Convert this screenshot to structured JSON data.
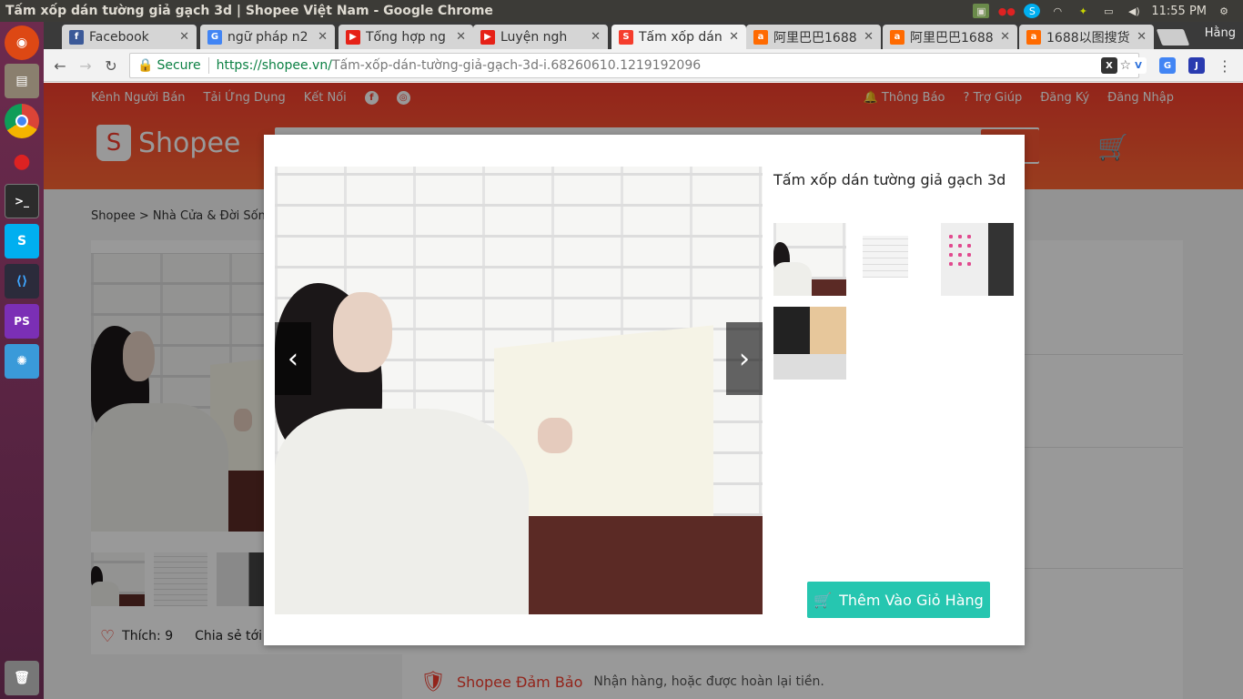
{
  "window": {
    "title": "Tấm xốp dán tường giả gạch 3d | Shopee Việt Nam - Google Chrome",
    "clock": "11:55 PM"
  },
  "tabs": [
    {
      "label": "Facebook",
      "icon": "facebook-icon",
      "color": "#3b5998",
      "glyph": "f"
    },
    {
      "label": "ngữ pháp n2",
      "icon": "google-icon",
      "color": "#4285f4",
      "glyph": "G"
    },
    {
      "label": "Tổng hợp ng",
      "icon": "youtube-icon",
      "color": "#e62117",
      "glyph": "▶"
    },
    {
      "label": "Luyện ngh",
      "icon": "youtube-icon",
      "color": "#e62117",
      "glyph": "▶"
    },
    {
      "label": "Tấm xốp dán",
      "icon": "shopee-icon",
      "color": "#f53d2d",
      "glyph": "S"
    },
    {
      "label": "阿里巴巴1688",
      "icon": "alibaba-icon",
      "color": "#ff6a00",
      "glyph": "a"
    },
    {
      "label": "阿里巴巴1688",
      "icon": "alibaba-icon",
      "color": "#ff6a00",
      "glyph": "a"
    },
    {
      "label": "1688以图搜货",
      "icon": "alibaba-icon",
      "color": "#ff6a00",
      "glyph": "a"
    }
  ],
  "user_chip": "Hằng",
  "address": {
    "secure_label": "Secure",
    "url_scheme_host": "https://shopee.vn/",
    "url_path": "Tấm-xốp-dán-tường-giả-gạch-3d-i.68260610.1219192096"
  },
  "header": {
    "links_left": [
      "Kênh Người Bán",
      "Tải Ứng Dụng",
      "Kết Nối"
    ],
    "notifications": "Thông Báo",
    "help": "Trợ Giúp",
    "register": "Đăng Ký",
    "login": "Đăng Nhập",
    "logo_text": "Shopee",
    "logo_glyph": "S"
  },
  "breadcrumb": {
    "home": "Shopee",
    "category": "Nhà Cửa & Đời Sống"
  },
  "product": {
    "likes": "Thích: 9",
    "share": "Chia sẻ tới"
  },
  "guarantee": {
    "title": "Shopee Đảm Bảo",
    "desc": "Nhận hàng, hoặc được hoàn lại tiền."
  },
  "modal": {
    "title": "Tấm xốp dán tường giả gạch 3d",
    "add_to_cart": "Thêm Vào Giỏ Hàng",
    "selected_thumb": 1
  },
  "colors": {
    "brand": "#f53d2d",
    "cart_button": "#26c6b0"
  }
}
